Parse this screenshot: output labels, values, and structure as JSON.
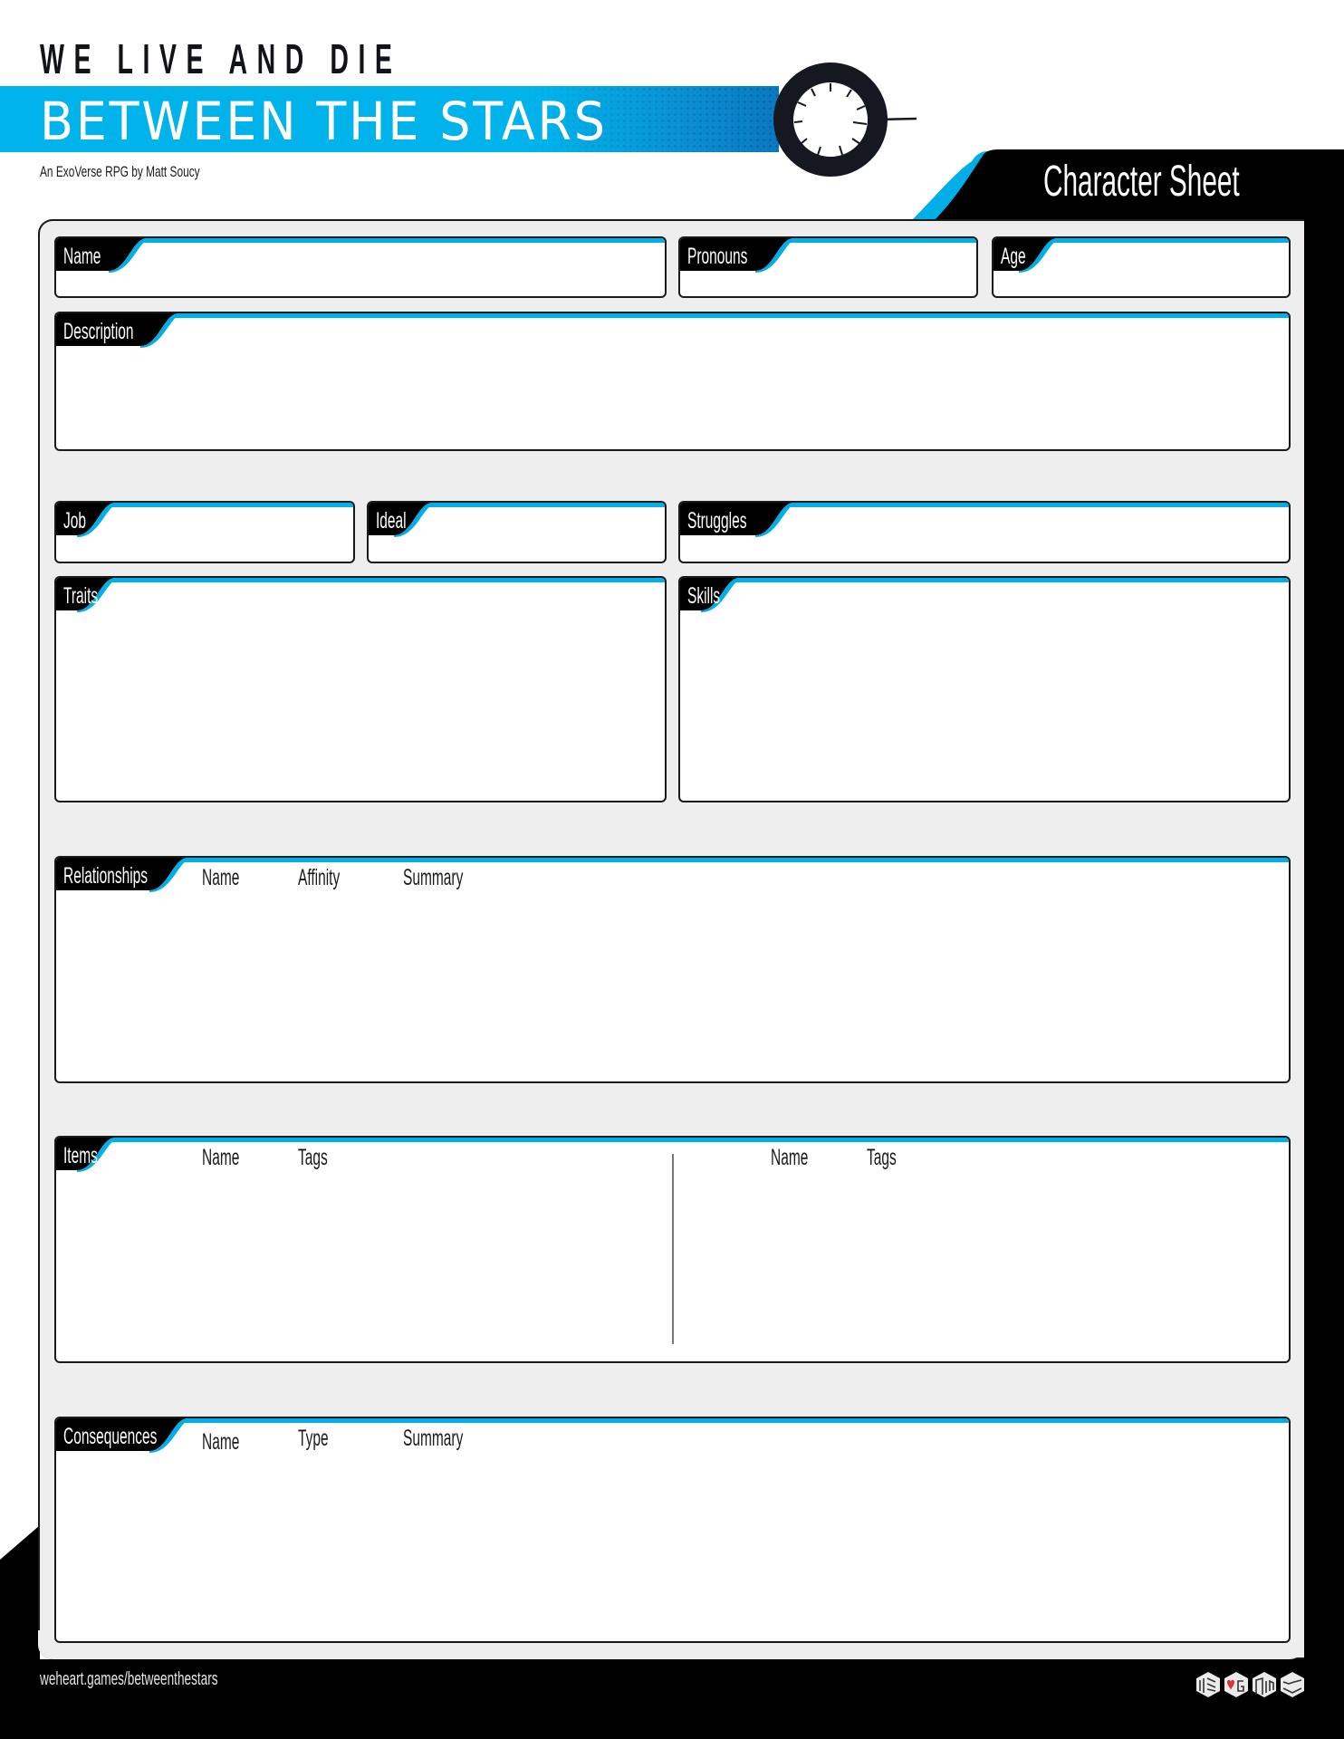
{
  "header": {
    "tagline": "WE LIVE AND DIE",
    "title": "BETWEEN THE STARS",
    "byline": "An ExoVerse RPG by Matt Soucy",
    "sheet_title": "Character Sheet"
  },
  "colors": {
    "accent": "#00aee8",
    "dark": "#000000",
    "frame": "#eeeeee",
    "logo_heart": "#e0323c"
  },
  "fields": {
    "name": {
      "label": "Name",
      "value": ""
    },
    "pronouns": {
      "label": "Pronouns",
      "value": ""
    },
    "age": {
      "label": "Age",
      "value": ""
    },
    "description": {
      "label": "Description",
      "value": ""
    },
    "job": {
      "label": "Job",
      "value": ""
    },
    "ideal": {
      "label": "Ideal",
      "value": ""
    },
    "struggles": {
      "label": "Struggles",
      "value": ""
    },
    "traits": {
      "label": "Traits",
      "value": ""
    },
    "skills": {
      "label": "Skills",
      "value": ""
    }
  },
  "tables": {
    "relationships": {
      "label": "Relationships",
      "columns": [
        "Name",
        "Affinity",
        "Summary"
      ]
    },
    "items": {
      "label": "Items",
      "columns_left": [
        "Name",
        "Tags"
      ],
      "columns_right": [
        "Name",
        "Tags"
      ]
    },
    "consequences": {
      "label": "Consequences",
      "columns": [
        "Name",
        "Type",
        "Summary"
      ]
    }
  },
  "footer": {
    "url": "weheart.games/betweenthestars",
    "logo_icon": "we-heart-games-cubes-icon"
  }
}
